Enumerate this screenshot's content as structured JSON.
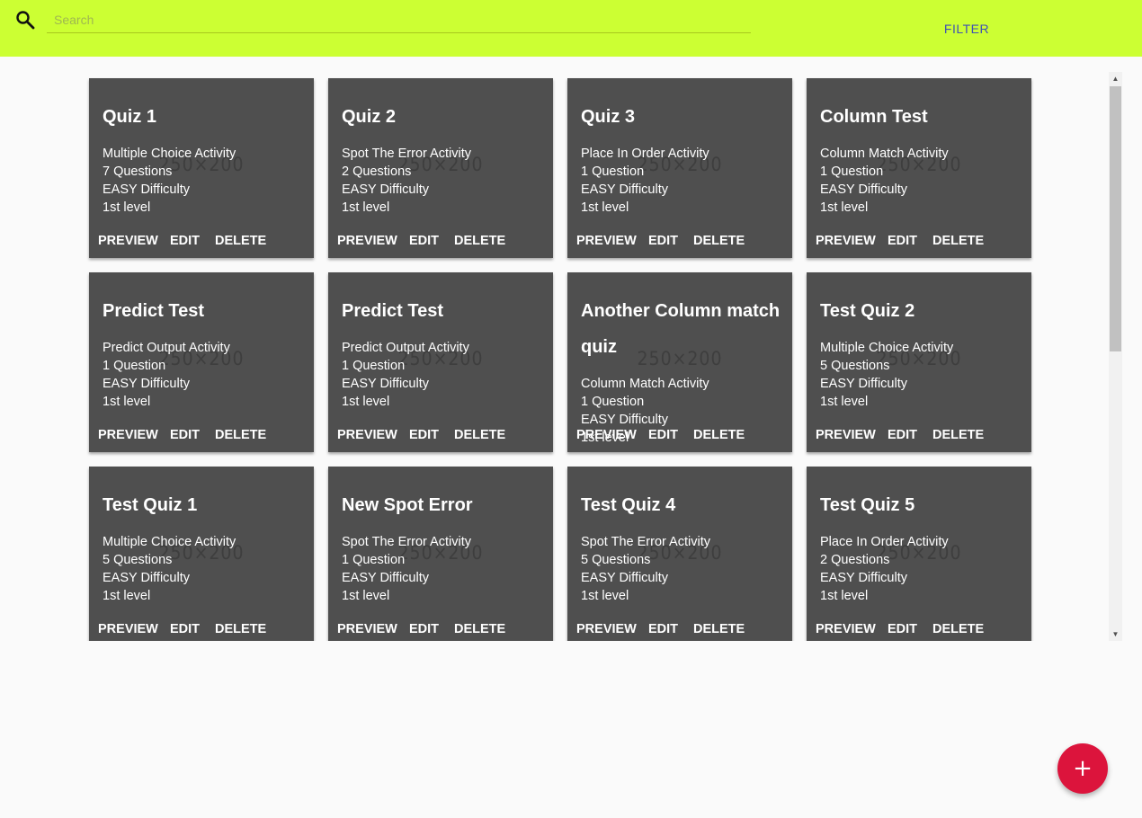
{
  "search": {
    "placeholder": "Search",
    "value": ""
  },
  "toolbar": {
    "filter_label": "FILTER"
  },
  "card_actions": {
    "preview": "PREVIEW",
    "edit": "EDIT",
    "delete": "DELETE"
  },
  "watermark": "250×200",
  "fab": {
    "label": "+"
  },
  "colors": {
    "topbar": "#ccff33",
    "card": "#4f4f4f",
    "fab": "#dc143c",
    "filter": "#3f51b5"
  },
  "quizzes": [
    {
      "title": "Quiz 1",
      "activity": "Multiple Choice Activity",
      "questions": "7 Questions",
      "difficulty": "EASY Difficulty",
      "level": "1st level"
    },
    {
      "title": "Quiz 2",
      "activity": "Spot The Error Activity",
      "questions": "2 Questions",
      "difficulty": "EASY Difficulty",
      "level": "1st level"
    },
    {
      "title": "Quiz 3",
      "activity": "Place In Order Activity",
      "questions": "1 Question",
      "difficulty": "EASY Difficulty",
      "level": "1st level"
    },
    {
      "title": "Column Test",
      "activity": "Column Match Activity",
      "questions": "1 Question",
      "difficulty": "EASY Difficulty",
      "level": "1st level"
    },
    {
      "title": "Predict Test",
      "activity": "Predict Output Activity",
      "questions": "1 Question",
      "difficulty": "EASY Difficulty",
      "level": "1st level"
    },
    {
      "title": "Predict Test",
      "activity": "Predict Output Activity",
      "questions": "1 Question",
      "difficulty": "EASY Difficulty",
      "level": "1st level"
    },
    {
      "title": "Another Column match quiz",
      "activity": "Column Match Activity",
      "questions": "1 Question",
      "difficulty": "EASY Difficulty",
      "level": "1st level"
    },
    {
      "title": "Test Quiz 2",
      "activity": "Multiple Choice Activity",
      "questions": "5 Questions",
      "difficulty": "EASY Difficulty",
      "level": "1st level"
    },
    {
      "title": "Test Quiz 1",
      "activity": "Multiple Choice Activity",
      "questions": "5 Questions",
      "difficulty": "EASY Difficulty",
      "level": "1st level"
    },
    {
      "title": "New Spot Error",
      "activity": "Spot The Error Activity",
      "questions": "1 Question",
      "difficulty": "EASY Difficulty",
      "level": "1st level"
    },
    {
      "title": "Test Quiz 4",
      "activity": "Spot The Error Activity",
      "questions": "5 Questions",
      "difficulty": "EASY Difficulty",
      "level": "1st level"
    },
    {
      "title": "Test Quiz 5",
      "activity": "Place In Order Activity",
      "questions": "2 Questions",
      "difficulty": "EASY Difficulty",
      "level": "1st level"
    }
  ]
}
